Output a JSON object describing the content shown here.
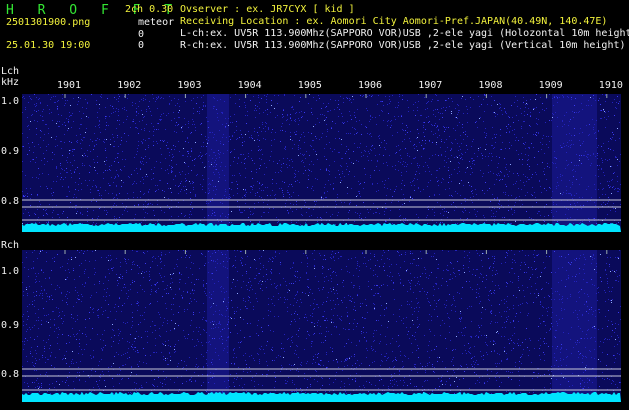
{
  "header": {
    "app_title": "H R O F F T",
    "filename": "2501301900.png",
    "datetime": "25.01.30 19:00",
    "version": "2ch 0.30",
    "meteor_label": "meteor",
    "meteor_count_l": "0",
    "meteor_count_r": "0",
    "observer_line": "Ovserver           : ex. JR7CYX [ kid ]",
    "location_line": "Receiving Location : ex. Aomori City Aomori-Pref.JAPAN(40.49N, 140.47E)",
    "lch_line": "L-ch:ex. UV5R 113.900Mhz(SAPPORO VOR)USB ,2-ele yagi (Holozontal 10m height)",
    "rch_line": "R-ch:ex. UV5R 113.900Mhz(SAPPORO VOR)USB ,2-ele yagi (Vertical 10m height)"
  },
  "time_ticks": [
    "1901",
    "1902",
    "1903",
    "1904",
    "1905",
    "1906",
    "1907",
    "1908",
    "1909",
    "1910"
  ],
  "lch": {
    "label": "Lch",
    "unit": "kHz",
    "yticks": [
      "1.0",
      "0.9",
      "0.8"
    ]
  },
  "rch": {
    "label": "Rch",
    "yticks": [
      "1.0",
      "0.9",
      "0.8"
    ]
  },
  "colors": {
    "background": "#000000",
    "noise": "#1a1acc",
    "trace": "#00e5ff",
    "text_green": "#33e633",
    "text_yellow": "#f2f23c"
  }
}
